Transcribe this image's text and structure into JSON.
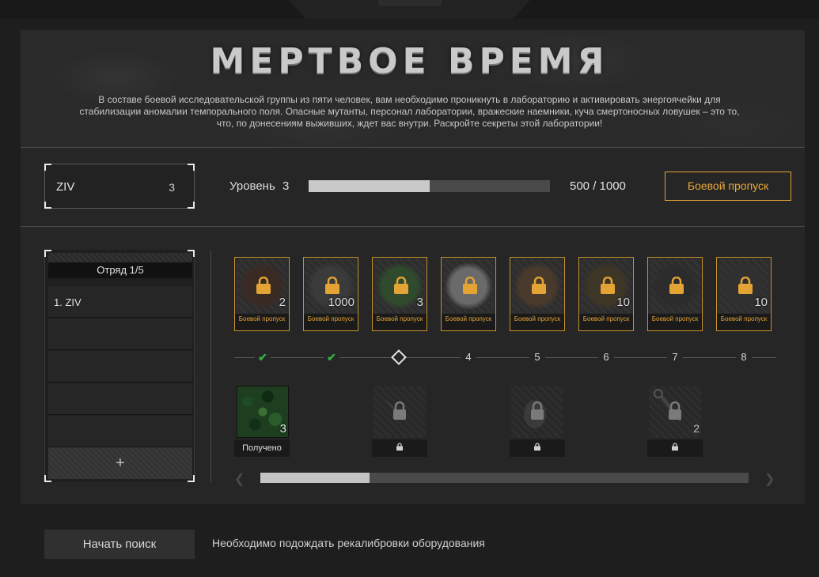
{
  "header": {
    "title": "МЕРТВОЕ ВРЕМЯ",
    "description": "В составе боевой исследовательской группы из пяти человек, вам необходимо проникнуть в лабораторию и активировать энергоячейки для стабилизации аномалии темпорального поля. Опасные мутанты, персонал лаборатории, вражеские наемники, куча смертоносных ловушек – это то, что, по донесениям выживших, ждет вас внутри. Раскройте секреты этой лаборатории!"
  },
  "player": {
    "name": "ZIV",
    "level": "3"
  },
  "progress": {
    "level_label": "Уровень",
    "level_value": "3",
    "xp_text": "500 / 1000",
    "xp_fraction": 0.5,
    "battle_pass_label": "Боевой пропуск"
  },
  "squad": {
    "title": "Отряд 1/5",
    "members": [
      "1.  ZIV"
    ],
    "add_label": "+"
  },
  "premium_rewards": [
    {
      "icon": "badge-reward-icon",
      "qty": "2",
      "label": "Боевой пропуск"
    },
    {
      "icon": "credits-reward-icon",
      "qty": "1000",
      "label": "Боевой пропуск"
    },
    {
      "icon": "weapon-paint-reward-icon",
      "qty": "3",
      "label": "Боевой пропуск"
    },
    {
      "icon": "token-reward-icon",
      "qty": "",
      "label": "Боевой пропуск"
    },
    {
      "icon": "mask-reward-icon",
      "qty": "",
      "label": "Боевой пропуск"
    },
    {
      "icon": "crate-reward-icon",
      "qty": "10",
      "label": "Боевой пропуск"
    },
    {
      "icon": "knife-reward-icon",
      "qty": "",
      "label": "Боевой пропуск"
    },
    {
      "icon": "ammo-reward-icon",
      "qty": "10",
      "label": "Боевой пропуск"
    }
  ],
  "track_nodes": [
    "4",
    "5",
    "6",
    "7",
    "8"
  ],
  "free_rewards": [
    {
      "icon": "camo-reward-icon",
      "qty": "3",
      "label": "Получено"
    },
    {
      "icon": "knife-reward-icon",
      "qty": "",
      "label": ""
    },
    {
      "icon": "grenade-reward-icon",
      "qty": "",
      "label": ""
    },
    {
      "icon": "keychain-reward-icon",
      "qty": "2",
      "label": ""
    }
  ],
  "footer": {
    "search_label": "Начать поиск",
    "wait_text": "Необходимо подождать рекалибровки оборудования"
  },
  "colors": {
    "accent": "#e3a335",
    "check": "#31b047"
  }
}
